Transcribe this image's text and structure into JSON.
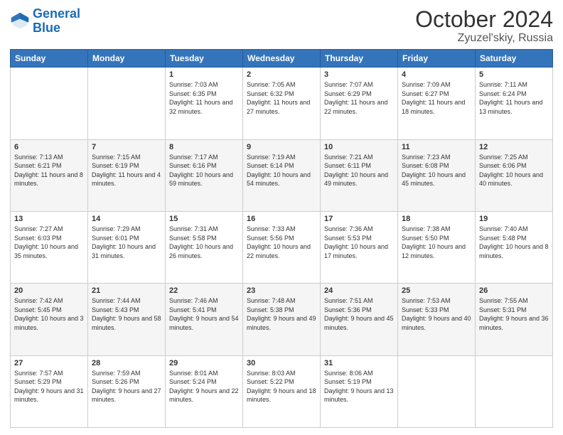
{
  "header": {
    "logo_line1": "General",
    "logo_line2": "Blue",
    "month": "October 2024",
    "location": "Zyuzel'skiy, Russia"
  },
  "weekdays": [
    "Sunday",
    "Monday",
    "Tuesday",
    "Wednesday",
    "Thursday",
    "Friday",
    "Saturday"
  ],
  "rows": [
    [
      {
        "day": "",
        "info": ""
      },
      {
        "day": "",
        "info": ""
      },
      {
        "day": "1",
        "info": "Sunrise: 7:03 AM\nSunset: 6:35 PM\nDaylight: 11 hours and 32 minutes."
      },
      {
        "day": "2",
        "info": "Sunrise: 7:05 AM\nSunset: 6:32 PM\nDaylight: 11 hours and 27 minutes."
      },
      {
        "day": "3",
        "info": "Sunrise: 7:07 AM\nSunset: 6:29 PM\nDaylight: 11 hours and 22 minutes."
      },
      {
        "day": "4",
        "info": "Sunrise: 7:09 AM\nSunset: 6:27 PM\nDaylight: 11 hours and 18 minutes."
      },
      {
        "day": "5",
        "info": "Sunrise: 7:11 AM\nSunset: 6:24 PM\nDaylight: 11 hours and 13 minutes."
      }
    ],
    [
      {
        "day": "6",
        "info": "Sunrise: 7:13 AM\nSunset: 6:21 PM\nDaylight: 11 hours and 8 minutes."
      },
      {
        "day": "7",
        "info": "Sunrise: 7:15 AM\nSunset: 6:19 PM\nDaylight: 11 hours and 4 minutes."
      },
      {
        "day": "8",
        "info": "Sunrise: 7:17 AM\nSunset: 6:16 PM\nDaylight: 10 hours and 59 minutes."
      },
      {
        "day": "9",
        "info": "Sunrise: 7:19 AM\nSunset: 6:14 PM\nDaylight: 10 hours and 54 minutes."
      },
      {
        "day": "10",
        "info": "Sunrise: 7:21 AM\nSunset: 6:11 PM\nDaylight: 10 hours and 49 minutes."
      },
      {
        "day": "11",
        "info": "Sunrise: 7:23 AM\nSunset: 6:08 PM\nDaylight: 10 hours and 45 minutes."
      },
      {
        "day": "12",
        "info": "Sunrise: 7:25 AM\nSunset: 6:06 PM\nDaylight: 10 hours and 40 minutes."
      }
    ],
    [
      {
        "day": "13",
        "info": "Sunrise: 7:27 AM\nSunset: 6:03 PM\nDaylight: 10 hours and 35 minutes."
      },
      {
        "day": "14",
        "info": "Sunrise: 7:29 AM\nSunset: 6:01 PM\nDaylight: 10 hours and 31 minutes."
      },
      {
        "day": "15",
        "info": "Sunrise: 7:31 AM\nSunset: 5:58 PM\nDaylight: 10 hours and 26 minutes."
      },
      {
        "day": "16",
        "info": "Sunrise: 7:33 AM\nSunset: 5:56 PM\nDaylight: 10 hours and 22 minutes."
      },
      {
        "day": "17",
        "info": "Sunrise: 7:36 AM\nSunset: 5:53 PM\nDaylight: 10 hours and 17 minutes."
      },
      {
        "day": "18",
        "info": "Sunrise: 7:38 AM\nSunset: 5:50 PM\nDaylight: 10 hours and 12 minutes."
      },
      {
        "day": "19",
        "info": "Sunrise: 7:40 AM\nSunset: 5:48 PM\nDaylight: 10 hours and 8 minutes."
      }
    ],
    [
      {
        "day": "20",
        "info": "Sunrise: 7:42 AM\nSunset: 5:45 PM\nDaylight: 10 hours and 3 minutes."
      },
      {
        "day": "21",
        "info": "Sunrise: 7:44 AM\nSunset: 5:43 PM\nDaylight: 9 hours and 58 minutes."
      },
      {
        "day": "22",
        "info": "Sunrise: 7:46 AM\nSunset: 5:41 PM\nDaylight: 9 hours and 54 minutes."
      },
      {
        "day": "23",
        "info": "Sunrise: 7:48 AM\nSunset: 5:38 PM\nDaylight: 9 hours and 49 minutes."
      },
      {
        "day": "24",
        "info": "Sunrise: 7:51 AM\nSunset: 5:36 PM\nDaylight: 9 hours and 45 minutes."
      },
      {
        "day": "25",
        "info": "Sunrise: 7:53 AM\nSunset: 5:33 PM\nDaylight: 9 hours and 40 minutes."
      },
      {
        "day": "26",
        "info": "Sunrise: 7:55 AM\nSunset: 5:31 PM\nDaylight: 9 hours and 36 minutes."
      }
    ],
    [
      {
        "day": "27",
        "info": "Sunrise: 7:57 AM\nSunset: 5:29 PM\nDaylight: 9 hours and 31 minutes."
      },
      {
        "day": "28",
        "info": "Sunrise: 7:59 AM\nSunset: 5:26 PM\nDaylight: 9 hours and 27 minutes."
      },
      {
        "day": "29",
        "info": "Sunrise: 8:01 AM\nSunset: 5:24 PM\nDaylight: 9 hours and 22 minutes."
      },
      {
        "day": "30",
        "info": "Sunrise: 8:03 AM\nSunset: 5:22 PM\nDaylight: 9 hours and 18 minutes."
      },
      {
        "day": "31",
        "info": "Sunrise: 8:06 AM\nSunset: 5:19 PM\nDaylight: 9 hours and 13 minutes."
      },
      {
        "day": "",
        "info": ""
      },
      {
        "day": "",
        "info": ""
      }
    ]
  ]
}
